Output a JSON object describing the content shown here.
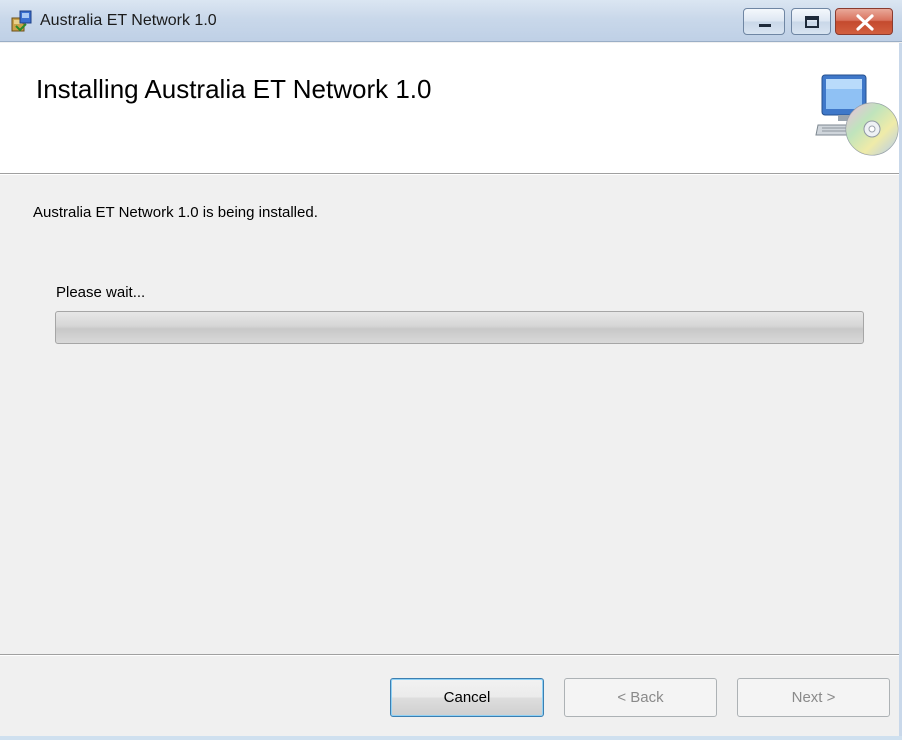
{
  "window": {
    "title": "Australia ET Network 1.0",
    "controls": {
      "minimize_icon": "minimize-icon",
      "maximize_icon": "maximize-icon",
      "close_icon": "close-icon"
    }
  },
  "banner": {
    "heading": "Installing Australia ET Network 1.0",
    "icon": "computer-cd-icon"
  },
  "main": {
    "status": "Australia ET Network 1.0 is being installed.",
    "wait_label": "Please wait...",
    "progress": 0
  },
  "footer": {
    "cancel_label": "Cancel",
    "back_label": "< Back",
    "next_label": "Next >"
  },
  "colors": {
    "titlebar": "#c9d8ea",
    "close_button": "#c44a2e",
    "focus_border": "#3c7fb1"
  }
}
